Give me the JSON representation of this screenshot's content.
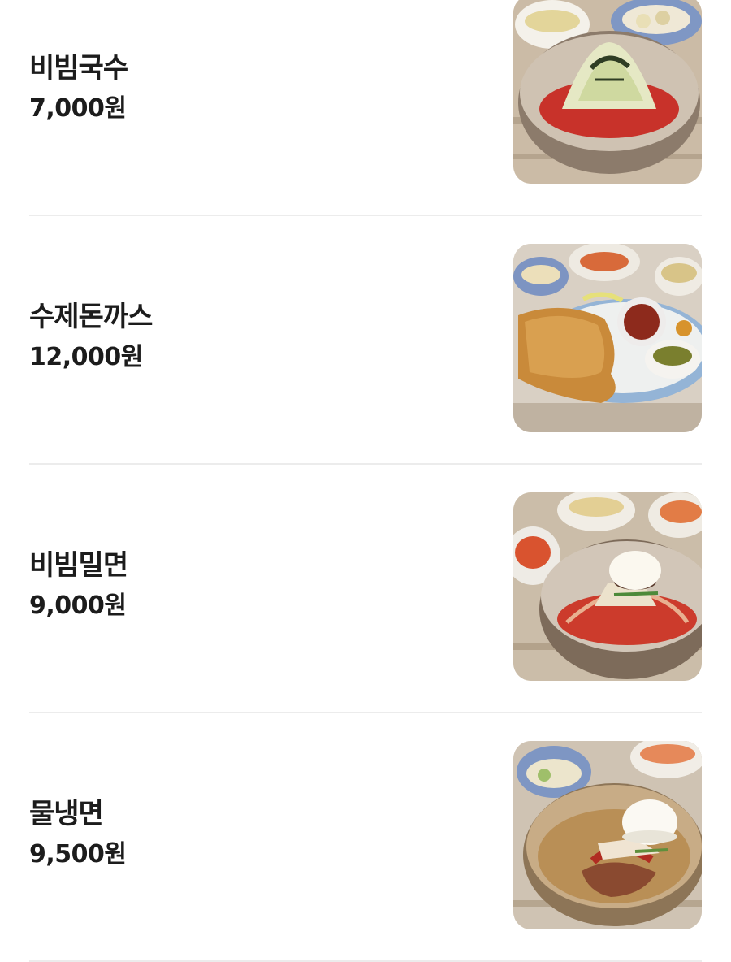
{
  "menu": {
    "items": [
      {
        "name": "비빔국수",
        "price": "7,000원",
        "image_icon": "bibim-guksu-photo-icon"
      },
      {
        "name": "수제돈까스",
        "price": "12,000원",
        "image_icon": "pork-cutlet-photo-icon"
      },
      {
        "name": "비빔밀면",
        "price": "9,000원",
        "image_icon": "bibim-milmyeon-photo-icon"
      },
      {
        "name": "물냉면",
        "price": "9,500원",
        "image_icon": "mul-naengmyeon-photo-icon"
      }
    ]
  },
  "colors": {
    "text": "#1c1c1c",
    "divider": "#ececec",
    "background": "#ffffff",
    "table_wood": "#cdbfae",
    "sauce_red": "#c8322a",
    "bowl_steel": "#b9a58f"
  }
}
